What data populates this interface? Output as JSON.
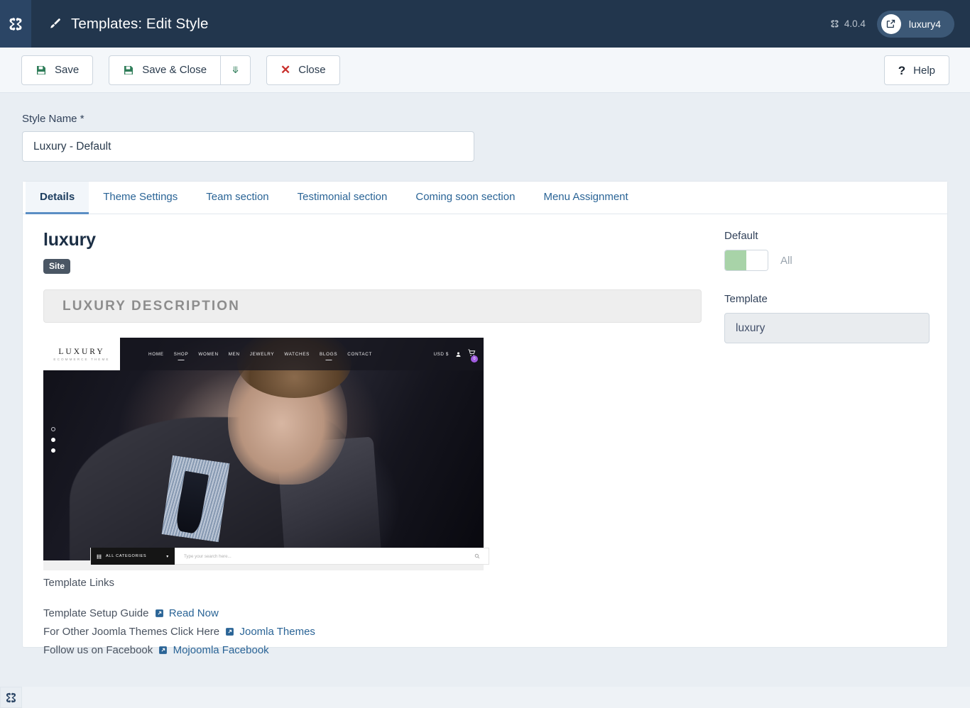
{
  "header": {
    "logo_icon": "joomla-logo-icon",
    "brush_icon": "brush-icon",
    "title": "Templates: Edit Style",
    "version": "4.0.4",
    "version_icon": "joomla-mark-icon",
    "site_chip_label": "luxury4",
    "site_chip_icon": "external-link-icon"
  },
  "toolbar": {
    "save_label": "Save",
    "save_icon": "floppy-disk-icon",
    "save_close_label": "Save & Close",
    "save_close_icon": "floppy-disk-icon",
    "dropdown_icon": "chevron-down-icon",
    "close_label": "Close",
    "close_icon": "x-icon",
    "help_label": "Help",
    "help_icon": "question-mark-icon"
  },
  "style_name": {
    "label": "Style Name *",
    "value": "Luxury - Default",
    "placeholder": "Style Name"
  },
  "tabs": [
    {
      "label": "Details",
      "active": true
    },
    {
      "label": "Theme Settings",
      "active": false
    },
    {
      "label": "Team section",
      "active": false
    },
    {
      "label": "Testimonial section",
      "active": false
    },
    {
      "label": "Coming soon section",
      "active": false
    },
    {
      "label": "Menu Assignment",
      "active": false
    }
  ],
  "details": {
    "template_title": "luxury",
    "client_badge": "Site",
    "description_header": "LUXURY DESCRIPTION",
    "preview": {
      "logo_main": "LUXURY",
      "logo_sub": "ECOMMERCE THEME",
      "menu": [
        "HOME",
        "SHOP",
        "WOMEN",
        "MEN",
        "JEWELRY",
        "WATCHES",
        "BLOGS",
        "CONTACT"
      ],
      "currency": "USD $",
      "user_icon": "user-icon",
      "cart_icon": "cart-icon",
      "cart_count": "0",
      "search_category": "ALL CATEGORIES",
      "search_category_icon": "grid-icon",
      "search_caret_icon": "chevron-down-icon",
      "search_placeholder": "Type your search here...",
      "search_icon": "search-icon"
    },
    "links_title": "Template Links",
    "links": [
      {
        "text": "Template Setup Guide",
        "icon": "external-link-icon",
        "link_label": "Read Now"
      },
      {
        "text": "For Other Joomla Themes Click Here",
        "icon": "external-link-icon",
        "link_label": "Joomla Themes"
      },
      {
        "text": "Follow us on Facebook",
        "icon": "external-link-icon",
        "link_label": "Mojoomla Facebook"
      }
    ]
  },
  "sidebar": {
    "default_label": "Default",
    "default_toggle_caption": "All",
    "default_toggle_state": "on",
    "template_label": "Template",
    "template_value": "luxury"
  },
  "footer": {
    "logo_icon": "joomla-logo-icon"
  },
  "colors": {
    "header_bg": "#22364d",
    "header_logo_bg": "#2b4565",
    "page_bg": "#e9eef3",
    "accent_link": "#2a6496",
    "tab_active_border": "#5b8ec4",
    "save_icon_green": "#2f7d59",
    "close_icon_red": "#c9302c",
    "toggle_on_green": "#a8d3a8",
    "badge_site_bg": "#4a5664",
    "cart_badge_purple": "#a05ce0"
  }
}
